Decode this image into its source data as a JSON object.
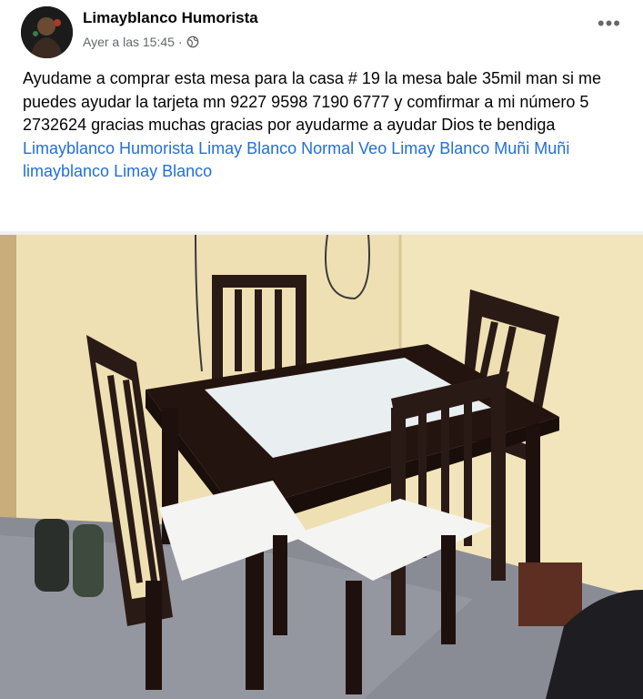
{
  "post": {
    "author": "Limayblanco Humorista",
    "timestamp": "Ayer a las 15:45",
    "separator": "·",
    "privacy_icon": "globe-icon",
    "more_icon": "more-options-icon",
    "more_label": "•••",
    "text": "Ayudame a comprar esta mesa para la casa # 19 la mesa bale 35mil man si me puedes ayudar la tarjeta mn 9227 9598 7190 6777 y comfirmar a mi número 5 2732624 gracias muchas gracias por ayudarme a ayudar Dios te bendiga",
    "hashtags": [
      "Limayblanco Humorista",
      "Limay Blanco Normal",
      "Veo Limay Blanco",
      "Muñi Muñi",
      "limayblanco",
      "Limay Blanco"
    ]
  },
  "colors": {
    "link": "#216fdb",
    "text": "#050505",
    "meta": "#65676b"
  }
}
